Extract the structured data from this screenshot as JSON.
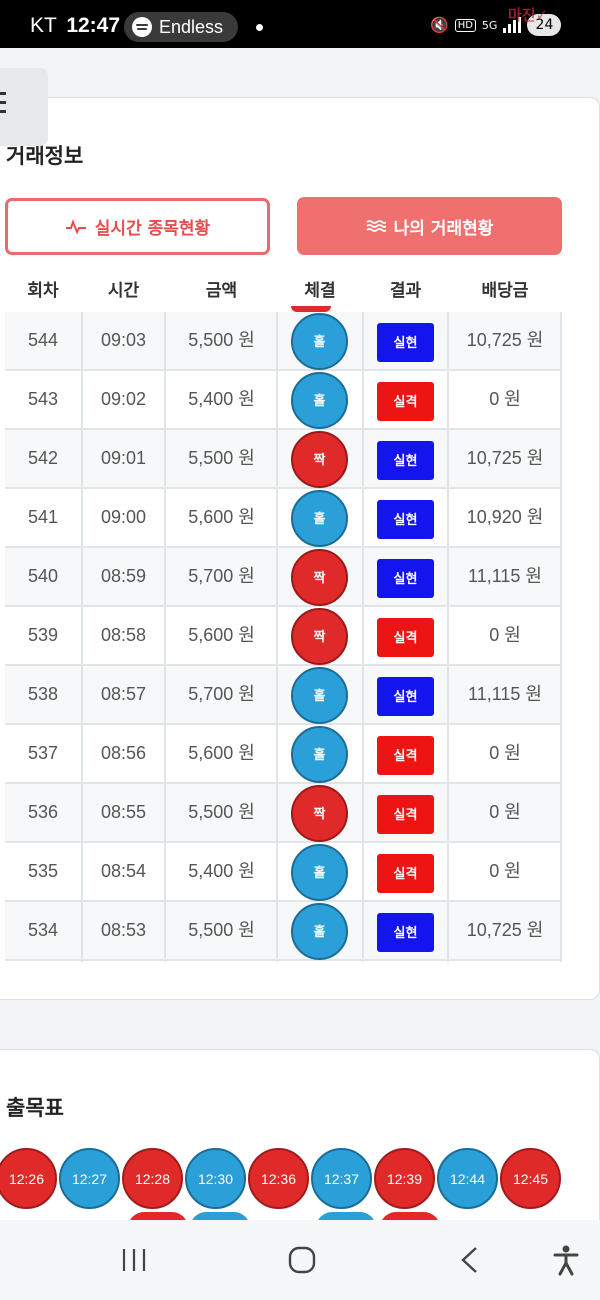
{
  "statusbar": {
    "carrier": "KT",
    "time": "12:47",
    "now_playing": "Endless",
    "network": "5G",
    "battery": "24",
    "hd_label": "HD"
  },
  "trade_info": {
    "title": "거래정보",
    "btn_realtime": "실시간 종목현황",
    "btn_my_trades": "나의 거래현황",
    "columns": [
      "회차",
      "시간",
      "금액",
      "체결",
      "결과",
      "배당금"
    ],
    "rows": [
      {
        "round": "544",
        "time": "09:03",
        "amount": "5,500 원",
        "pick": "홀",
        "result": "실현",
        "payout": "10,725 원"
      },
      {
        "round": "543",
        "time": "09:02",
        "amount": "5,400 원",
        "pick": "홀",
        "result": "실격",
        "payout": "0 원"
      },
      {
        "round": "542",
        "time": "09:01",
        "amount": "5,500 원",
        "pick": "짝",
        "result": "실현",
        "payout": "10,725 원"
      },
      {
        "round": "541",
        "time": "09:00",
        "amount": "5,600 원",
        "pick": "홀",
        "result": "실현",
        "payout": "10,920 원"
      },
      {
        "round": "540",
        "time": "08:59",
        "amount": "5,700 원",
        "pick": "짝",
        "result": "실현",
        "payout": "11,115 원"
      },
      {
        "round": "539",
        "time": "08:58",
        "amount": "5,600 원",
        "pick": "짝",
        "result": "실격",
        "payout": "0 원"
      },
      {
        "round": "538",
        "time": "08:57",
        "amount": "5,700 원",
        "pick": "홀",
        "result": "실현",
        "payout": "11,115 원"
      },
      {
        "round": "537",
        "time": "08:56",
        "amount": "5,600 원",
        "pick": "홀",
        "result": "실격",
        "payout": "0 원"
      },
      {
        "round": "536",
        "time": "08:55",
        "amount": "5,500 원",
        "pick": "짝",
        "result": "실격",
        "payout": "0 원"
      },
      {
        "round": "535",
        "time": "08:54",
        "amount": "5,400 원",
        "pick": "홀",
        "result": "실격",
        "payout": "0 원"
      },
      {
        "round": "534",
        "time": "08:53",
        "amount": "5,500 원",
        "pick": "홀",
        "result": "실현",
        "payout": "10,725 원"
      }
    ]
  },
  "chart_section": {
    "title": "출목표",
    "chips": [
      {
        "time": "12:26",
        "color": "red"
      },
      {
        "time": "12:27",
        "color": "blue"
      },
      {
        "time": "12:28",
        "color": "red"
      },
      {
        "time": "12:30",
        "color": "blue"
      },
      {
        "time": "12:36",
        "color": "red"
      },
      {
        "time": "12:37",
        "color": "blue"
      },
      {
        "time": "12:39",
        "color": "red"
      },
      {
        "time": "12:44",
        "color": "blue"
      },
      {
        "time": "12:45",
        "color": "red"
      }
    ]
  },
  "colors": {
    "odd_ball": "#2b9fd8",
    "even_ball": "#e02a2a",
    "win_badge": "#1414ee",
    "lose_badge": "#ee1414",
    "accent": "#f07070"
  },
  "icons": {
    "menu": "hamburger-icon",
    "realtime": "pulse-icon",
    "my_trades": "wave-lines-icon",
    "nav_recents": "recents-icon",
    "nav_home": "home-icon",
    "nav_back": "back-icon",
    "nav_accessibility": "accessibility-icon"
  }
}
